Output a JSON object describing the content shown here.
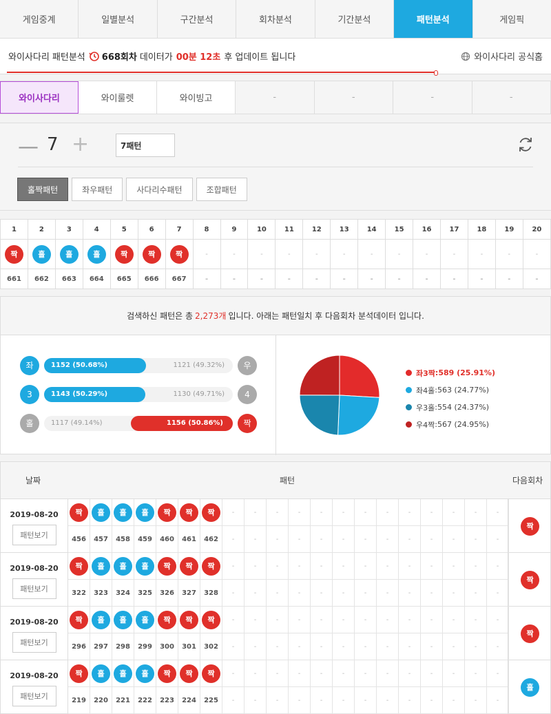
{
  "nav": {
    "tabs": [
      "게임중계",
      "일별분석",
      "구간분석",
      "회차분석",
      "기간분석",
      "패턴분석",
      "게임픽"
    ],
    "active_index": 5
  },
  "info": {
    "prefix": "와이사다리 패턴분석",
    "round": "668회차",
    "middle": "데이터가",
    "countdown": "00분 12초",
    "suffix": "후 업데이트 됩니다",
    "official_link": "와이사다리 공식홈"
  },
  "subnav": {
    "items": [
      "와이사다리",
      "와이룰렛",
      "와이빙고",
      "-",
      "-",
      "-",
      "-"
    ],
    "active_index": 0
  },
  "controls": {
    "count": "7",
    "pattern_input": "7패턴",
    "pattern_buttons": [
      "홀짝패턴",
      "좌우패턴",
      "사다리수패턴",
      "조합패턴"
    ],
    "active_index": 0
  },
  "grid": {
    "columns": [
      "1",
      "2",
      "3",
      "4",
      "5",
      "6",
      "7",
      "8",
      "9",
      "10",
      "11",
      "12",
      "13",
      "14",
      "15",
      "16",
      "17",
      "18",
      "19",
      "20"
    ],
    "balls": [
      "짝",
      "홀",
      "홀",
      "홀",
      "짝",
      "짝",
      "짝"
    ],
    "rounds": [
      "661",
      "662",
      "663",
      "664",
      "665",
      "666",
      "667"
    ],
    "dash": "-"
  },
  "stats": {
    "head_prefix": "검색하신 패턴은 총",
    "head_count": "2,273개",
    "head_suffix": "입니다. 아래는 패턴일치 후 다음회차 분석데이터 입니다.",
    "bars": [
      {
        "left_label": "좌",
        "right_label": "우",
        "left_text": "1152 (50.68%)",
        "right_text": "1121 (49.32%)",
        "left_pct": 50.68,
        "winner": "left",
        "fill_color": "#1ea9e0"
      },
      {
        "left_label": "3",
        "right_label": "4",
        "left_text": "1143 (50.29%)",
        "right_text": "1130 (49.71%)",
        "left_pct": 50.29,
        "winner": "left",
        "fill_color": "#1ea9e0"
      },
      {
        "left_label": "홀",
        "right_label": "짝",
        "left_text": "1117 (49.14%)",
        "right_text": "1156 (50.86%)",
        "left_pct": 49.14,
        "winner": "right",
        "fill_color": "#e0302a"
      }
    ],
    "pie": [
      {
        "label": "좌3짝",
        "value": 589,
        "pct_text": "589 (25.91%)",
        "color": "#e32b2b"
      },
      {
        "label": "좌4홀",
        "value": 563,
        "pct_text": "563 (24.77%)",
        "color": "#1ea9e0"
      },
      {
        "label": "우3홀",
        "value": 554,
        "pct_text": "554 (24.37%)",
        "color": "#1a86ad"
      },
      {
        "label": "우4짝",
        "value": 567,
        "pct_text": "567 (24.95%)",
        "color": "#bf2222"
      }
    ]
  },
  "results": {
    "header_date": "날짜",
    "header_pattern": "패턴",
    "header_next": "다음회차",
    "view_label": "패턴보기",
    "dash": "-",
    "rows": [
      {
        "date": "2019-08-20",
        "balls": [
          "짝",
          "홀",
          "홀",
          "홀",
          "짝",
          "짝",
          "짝"
        ],
        "rounds": [
          "456",
          "457",
          "458",
          "459",
          "460",
          "461",
          "462"
        ],
        "next": "짝"
      },
      {
        "date": "2019-08-20",
        "balls": [
          "짝",
          "홀",
          "홀",
          "홀",
          "짝",
          "짝",
          "짝"
        ],
        "rounds": [
          "322",
          "323",
          "324",
          "325",
          "326",
          "327",
          "328"
        ],
        "next": "짝"
      },
      {
        "date": "2019-08-20",
        "balls": [
          "짝",
          "홀",
          "홀",
          "홀",
          "짝",
          "짝",
          "짝"
        ],
        "rounds": [
          "296",
          "297",
          "298",
          "299",
          "300",
          "301",
          "302"
        ],
        "next": "짝"
      },
      {
        "date": "2019-08-20",
        "balls": [
          "짝",
          "홀",
          "홀",
          "홀",
          "짝",
          "짝",
          "짝"
        ],
        "rounds": [
          "219",
          "220",
          "221",
          "222",
          "223",
          "224",
          "225"
        ],
        "next": "홀"
      }
    ]
  },
  "colors": {
    "red": "#e0302a",
    "blue": "#1ea9e0",
    "accent": "#1ea9e0",
    "purple": "#9a30c0"
  }
}
